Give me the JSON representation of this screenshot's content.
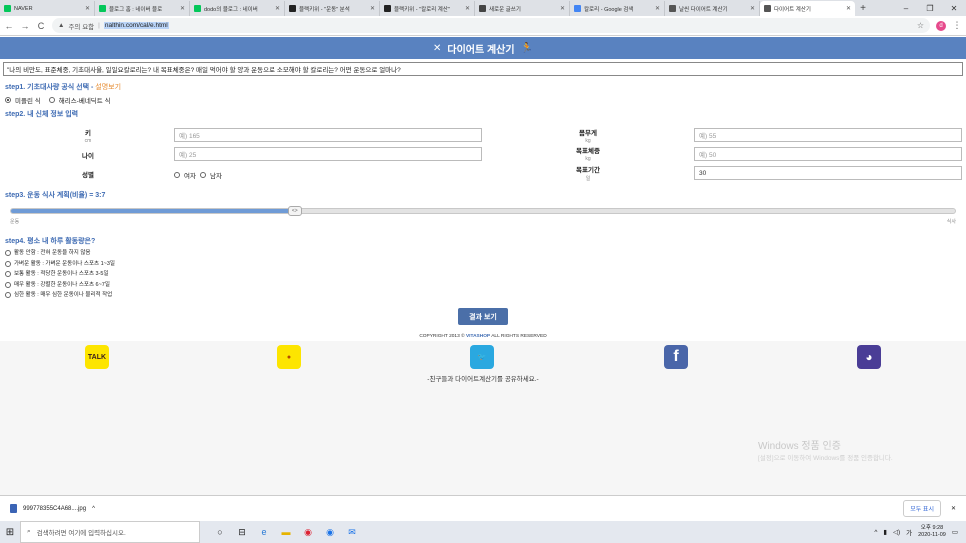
{
  "browser": {
    "tabs": [
      {
        "title": "NAVER",
        "color": "#03c75a"
      },
      {
        "title": "블로그 홈 : 네이버 블로",
        "color": "#03c75a"
      },
      {
        "title": "dodo의 블로그 : 네이버",
        "color": "#03c75a"
      },
      {
        "title": "블랙키위 - \"운동\" 분석",
        "color": "#222222"
      },
      {
        "title": "블랙키위 - \"칼로리 계산\"",
        "color": "#222222"
      },
      {
        "title": "새로운 글쓰기",
        "color": "#444444"
      },
      {
        "title": "칼로리 - Google 검색",
        "color": "#4285f4"
      },
      {
        "title": "날씬 다이어트 계산기",
        "color": "#555555"
      },
      {
        "title": "다이어트 계산기",
        "color": "#555555",
        "active": true
      }
    ],
    "address": {
      "security": "주의 요함",
      "url": "nalthin.com/cal/e.html"
    },
    "profile_initial": "d"
  },
  "page": {
    "title": "다이어트 계산기",
    "intro": "\"나의 비만도, 표준체중, 기초대사율, 일일요칼로리는? 내 목표체중은? 매일 먹어야 할 양과 운동으로 소모해야 할 칼로리는? 어떤 운동으로 얼마나?",
    "step1": {
      "heading": "step1. 기초대사량 공식 선택",
      "link": "설명보기",
      "options": [
        "미플린 식",
        "해리스-베네딕트 식"
      ]
    },
    "step2": {
      "heading": "step2. 내 신체 정보 입력",
      "height": {
        "label": "키",
        "unit": "cm",
        "placeholder": "예) 165"
      },
      "age": {
        "label": "나이",
        "placeholder": "예) 25"
      },
      "gender": {
        "label": "성별",
        "options": [
          "여자",
          "남자"
        ]
      },
      "weight": {
        "label": "몸무게",
        "unit": "kg",
        "placeholder": "예) 55"
      },
      "goal_weight": {
        "label": "목표체중",
        "unit": "kg",
        "placeholder": "예) 50"
      },
      "goal_period": {
        "label": "목표기간",
        "unit": "일",
        "value": "30"
      }
    },
    "step3": {
      "heading": "step3. 운동 식사 계획(비율) = 3:7",
      "left": "운동",
      "right": "식사",
      "handle": "<>",
      "ratio_fraction": 0.3
    },
    "step4": {
      "heading": "step4. 평소 내 하루 활동량은?",
      "options": [
        "활동 안함 : 전혀 운동을 하지 않음",
        "가벼운 활동 : 가벼운 운동이나 스포츠 1~3일",
        "보통 활동 : 적당한 운동이나 스포츠 3-5일",
        "매우 활동 : 강렬한 운동이나 스포츠 6~7일",
        "심한 활동 : 매우 심한 운동이나 물리적 작업"
      ]
    },
    "result_button": "결과 보기",
    "copyright_pre": "COPYRIGHT 2013 ©",
    "copyright_brand": "VITASHOP",
    "copyright_post": "ALL RIGHTS RESERVED",
    "share_text": "-친구들과 다이어트계산기를 공유하세요.-",
    "share_icons": [
      {
        "name": "kakaotalk",
        "text": "TALK",
        "bg": "#fde500",
        "fg": "#3a1d1d"
      },
      {
        "name": "kakaostory",
        "text": "●",
        "bg": "#fde500",
        "fg": "#b44b00"
      },
      {
        "name": "twitter",
        "text": "🐦",
        "bg": "#2aa8e0",
        "fg": "#ffffff"
      },
      {
        "name": "facebook",
        "text": "f",
        "bg": "#4a66a9",
        "fg": "#ffffff"
      },
      {
        "name": "band",
        "text": "◕",
        "bg": "#4a3d96",
        "fg": "#ffffff"
      }
    ]
  },
  "windows_watermark": {
    "title": "Windows 정품 인증",
    "sub": "[설정]으로 이동하여 Windows를 정품 인증합니다."
  },
  "download": {
    "file": "999778355C4A68....jpg",
    "show_all": "모두 표시"
  },
  "taskbar": {
    "search_placeholder": "검색하려면 여기에 입력하십시오.",
    "ime": "가",
    "time": "오후 9:28",
    "date": "2020-11-09"
  }
}
